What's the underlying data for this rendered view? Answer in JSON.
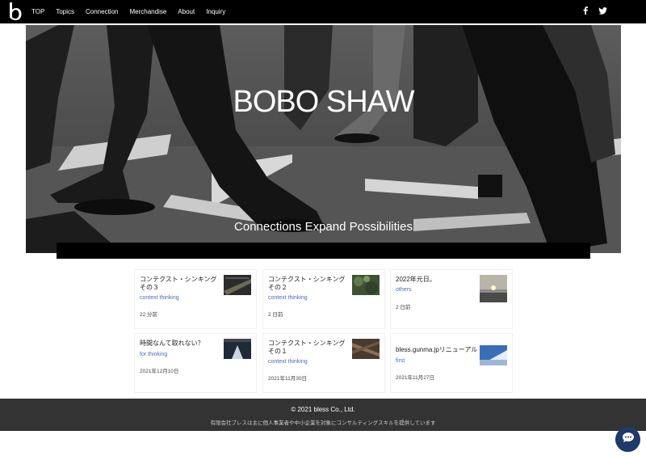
{
  "nav": {
    "links": [
      "TOP",
      "Topics",
      "Connection",
      "Merchandise",
      "About",
      "Inquiry"
    ]
  },
  "hero": {
    "title": "BOBO SHAW",
    "tagline": "Connections Expand Possibilities"
  },
  "posts": [
    {
      "title": "コンテクスト・シンキング　その３",
      "category": "context thinking",
      "date": "22 分前"
    },
    {
      "title": "コンテクスト・シンキング　その２",
      "category": "context thinking",
      "date": "2 日前"
    },
    {
      "title": "2022年元日。",
      "category": "others",
      "date": "2 日前"
    },
    {
      "title": "時間なんて取れない？",
      "category": "for thinking",
      "date": "2021年12月10日"
    },
    {
      "title": "コンテクスト・シンキング その１",
      "category": "context thinking",
      "date": "2021年11月30日"
    },
    {
      "title": "bless.gunma.jpリニューアル",
      "category": "first",
      "date": "2021年11月27日"
    }
  ],
  "footer": {
    "copyright": "© 2021 bless Co., Ltd.",
    "description": "有限会社ブレスは主に個人事業者や中小企業を対象にコンサルティングスキルを提供しています"
  },
  "icons": {
    "logo": "b-logo-icon",
    "facebook": "facebook-icon",
    "twitter": "twitter-icon",
    "chat": "chat-icon"
  },
  "colors": {
    "nav_bg": "#000000",
    "link": "#4a6cc4",
    "footer_bg": "#333333",
    "chat_bg": "#1d3a6b"
  }
}
